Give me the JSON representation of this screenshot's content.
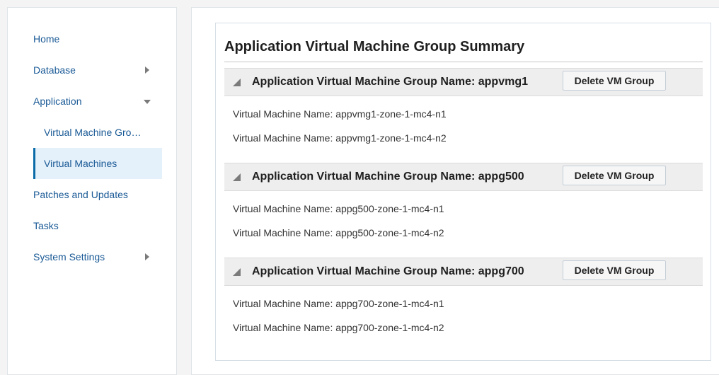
{
  "nav": {
    "items": [
      {
        "label": "Home"
      },
      {
        "label": "Database"
      },
      {
        "label": "Application"
      },
      {
        "label": "Virtual Machine Groups"
      },
      {
        "label": "Virtual Machines"
      },
      {
        "label": "Patches and Updates"
      },
      {
        "label": "Tasks"
      },
      {
        "label": "System Settings"
      }
    ]
  },
  "main": {
    "title": "Application Virtual Machine Group Summary",
    "groups": [
      {
        "name": "Application Virtual Machine Group Name: appvmg1",
        "delete_label": "Delete VM Group",
        "vms": [
          "Virtual Machine Name: appvmg1-zone-1-mc4-n1",
          "Virtual Machine Name: appvmg1-zone-1-mc4-n2"
        ]
      },
      {
        "name": "Application Virtual Machine Group Name: appg500",
        "delete_label": "Delete VM Group",
        "vms": [
          "Virtual Machine Name: appg500-zone-1-mc4-n1",
          "Virtual Machine Name: appg500-zone-1-mc4-n2"
        ]
      },
      {
        "name": "Application Virtual Machine Group Name: appg700",
        "delete_label": "Delete VM Group",
        "vms": [
          "Virtual Machine Name: appg700-zone-1-mc4-n1",
          "Virtual Machine Name: appg700-zone-1-mc4-n2"
        ]
      }
    ]
  }
}
